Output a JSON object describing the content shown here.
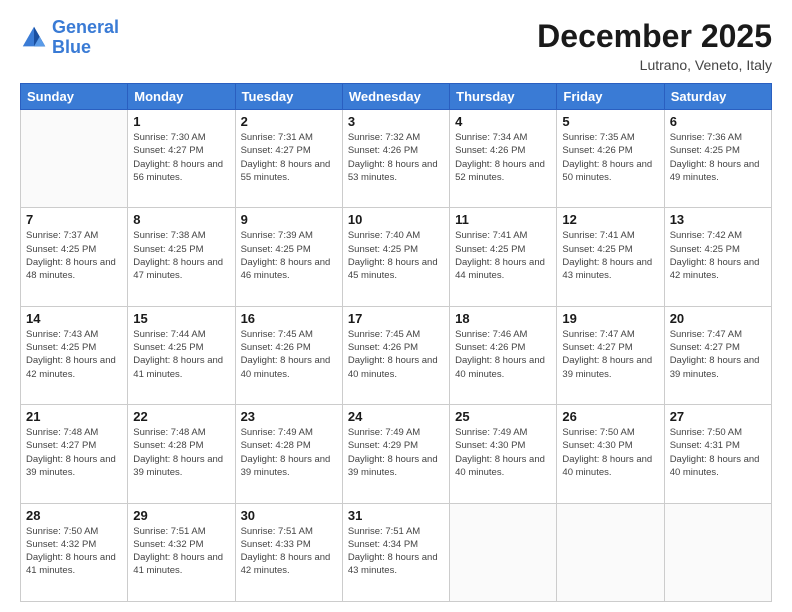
{
  "header": {
    "logo_line1": "General",
    "logo_line2": "Blue",
    "month": "December 2025",
    "location": "Lutrano, Veneto, Italy"
  },
  "weekdays": [
    "Sunday",
    "Monday",
    "Tuesday",
    "Wednesday",
    "Thursday",
    "Friday",
    "Saturday"
  ],
  "weeks": [
    [
      {
        "day": "",
        "info": ""
      },
      {
        "day": "1",
        "info": "Sunrise: 7:30 AM\nSunset: 4:27 PM\nDaylight: 8 hours\nand 56 minutes."
      },
      {
        "day": "2",
        "info": "Sunrise: 7:31 AM\nSunset: 4:27 PM\nDaylight: 8 hours\nand 55 minutes."
      },
      {
        "day": "3",
        "info": "Sunrise: 7:32 AM\nSunset: 4:26 PM\nDaylight: 8 hours\nand 53 minutes."
      },
      {
        "day": "4",
        "info": "Sunrise: 7:34 AM\nSunset: 4:26 PM\nDaylight: 8 hours\nand 52 minutes."
      },
      {
        "day": "5",
        "info": "Sunrise: 7:35 AM\nSunset: 4:26 PM\nDaylight: 8 hours\nand 50 minutes."
      },
      {
        "day": "6",
        "info": "Sunrise: 7:36 AM\nSunset: 4:25 PM\nDaylight: 8 hours\nand 49 minutes."
      }
    ],
    [
      {
        "day": "7",
        "info": "Sunrise: 7:37 AM\nSunset: 4:25 PM\nDaylight: 8 hours\nand 48 minutes."
      },
      {
        "day": "8",
        "info": "Sunrise: 7:38 AM\nSunset: 4:25 PM\nDaylight: 8 hours\nand 47 minutes."
      },
      {
        "day": "9",
        "info": "Sunrise: 7:39 AM\nSunset: 4:25 PM\nDaylight: 8 hours\nand 46 minutes."
      },
      {
        "day": "10",
        "info": "Sunrise: 7:40 AM\nSunset: 4:25 PM\nDaylight: 8 hours\nand 45 minutes."
      },
      {
        "day": "11",
        "info": "Sunrise: 7:41 AM\nSunset: 4:25 PM\nDaylight: 8 hours\nand 44 minutes."
      },
      {
        "day": "12",
        "info": "Sunrise: 7:41 AM\nSunset: 4:25 PM\nDaylight: 8 hours\nand 43 minutes."
      },
      {
        "day": "13",
        "info": "Sunrise: 7:42 AM\nSunset: 4:25 PM\nDaylight: 8 hours\nand 42 minutes."
      }
    ],
    [
      {
        "day": "14",
        "info": "Sunrise: 7:43 AM\nSunset: 4:25 PM\nDaylight: 8 hours\nand 42 minutes."
      },
      {
        "day": "15",
        "info": "Sunrise: 7:44 AM\nSunset: 4:25 PM\nDaylight: 8 hours\nand 41 minutes."
      },
      {
        "day": "16",
        "info": "Sunrise: 7:45 AM\nSunset: 4:26 PM\nDaylight: 8 hours\nand 40 minutes."
      },
      {
        "day": "17",
        "info": "Sunrise: 7:45 AM\nSunset: 4:26 PM\nDaylight: 8 hours\nand 40 minutes."
      },
      {
        "day": "18",
        "info": "Sunrise: 7:46 AM\nSunset: 4:26 PM\nDaylight: 8 hours\nand 40 minutes."
      },
      {
        "day": "19",
        "info": "Sunrise: 7:47 AM\nSunset: 4:27 PM\nDaylight: 8 hours\nand 39 minutes."
      },
      {
        "day": "20",
        "info": "Sunrise: 7:47 AM\nSunset: 4:27 PM\nDaylight: 8 hours\nand 39 minutes."
      }
    ],
    [
      {
        "day": "21",
        "info": "Sunrise: 7:48 AM\nSunset: 4:27 PM\nDaylight: 8 hours\nand 39 minutes."
      },
      {
        "day": "22",
        "info": "Sunrise: 7:48 AM\nSunset: 4:28 PM\nDaylight: 8 hours\nand 39 minutes."
      },
      {
        "day": "23",
        "info": "Sunrise: 7:49 AM\nSunset: 4:28 PM\nDaylight: 8 hours\nand 39 minutes."
      },
      {
        "day": "24",
        "info": "Sunrise: 7:49 AM\nSunset: 4:29 PM\nDaylight: 8 hours\nand 39 minutes."
      },
      {
        "day": "25",
        "info": "Sunrise: 7:49 AM\nSunset: 4:30 PM\nDaylight: 8 hours\nand 40 minutes."
      },
      {
        "day": "26",
        "info": "Sunrise: 7:50 AM\nSunset: 4:30 PM\nDaylight: 8 hours\nand 40 minutes."
      },
      {
        "day": "27",
        "info": "Sunrise: 7:50 AM\nSunset: 4:31 PM\nDaylight: 8 hours\nand 40 minutes."
      }
    ],
    [
      {
        "day": "28",
        "info": "Sunrise: 7:50 AM\nSunset: 4:32 PM\nDaylight: 8 hours\nand 41 minutes."
      },
      {
        "day": "29",
        "info": "Sunrise: 7:51 AM\nSunset: 4:32 PM\nDaylight: 8 hours\nand 41 minutes."
      },
      {
        "day": "30",
        "info": "Sunrise: 7:51 AM\nSunset: 4:33 PM\nDaylight: 8 hours\nand 42 minutes."
      },
      {
        "day": "31",
        "info": "Sunrise: 7:51 AM\nSunset: 4:34 PM\nDaylight: 8 hours\nand 43 minutes."
      },
      {
        "day": "",
        "info": ""
      },
      {
        "day": "",
        "info": ""
      },
      {
        "day": "",
        "info": ""
      }
    ]
  ]
}
